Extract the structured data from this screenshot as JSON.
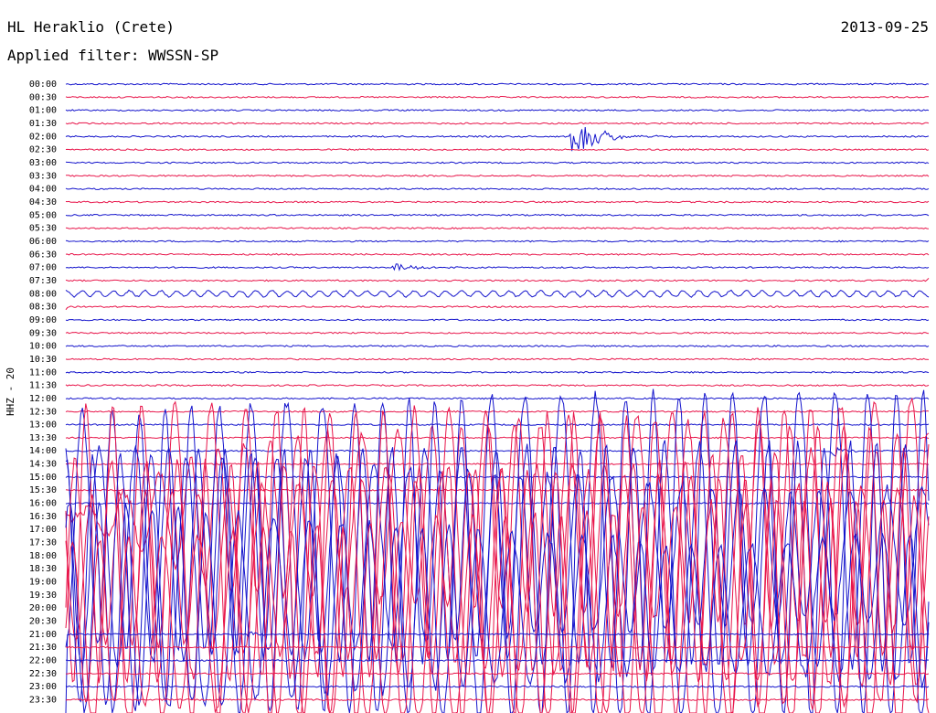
{
  "header": {
    "station": "HL Heraklio (Crete)",
    "date": "2013-09-25",
    "filter_text": "Applied filter: WWSSN-SP"
  },
  "channel_label": "HHZ - 20",
  "colors": {
    "trace_a": "#1414cc",
    "trace_b": "#e8154a"
  },
  "chart_data": {
    "type": "line",
    "title": "",
    "xlabel": "",
    "ylabel": "",
    "row_times": [
      "00:00",
      "00:30",
      "01:00",
      "01:30",
      "02:00",
      "02:30",
      "03:00",
      "03:30",
      "04:00",
      "04:30",
      "05:00",
      "05:30",
      "06:00",
      "06:30",
      "07:00",
      "07:30",
      "08:00",
      "08:30",
      "09:00",
      "09:30",
      "10:00",
      "10:30",
      "11:00",
      "11:30",
      "12:00",
      "12:30",
      "13:00",
      "13:30",
      "14:00",
      "14:30",
      "15:00",
      "15:30",
      "16:00",
      "16:30",
      "17:00",
      "17:30",
      "18:00",
      "18:30",
      "19:00",
      "19:30",
      "20:00",
      "20:30",
      "21:00",
      "21:30",
      "22:00",
      "22:30",
      "23:00",
      "23:30"
    ],
    "row_minutes": 30,
    "events": [
      {
        "start_hhmm": "02:00",
        "offset_min": 17.5,
        "duration_min": 3.5,
        "amplitude": "large"
      },
      {
        "start_hhmm": "07:00",
        "offset_min": 11.3,
        "duration_min": 3.5,
        "amplitude": "small"
      },
      {
        "start_hhmm": "08:00",
        "offset_min": 0,
        "duration_min": 30,
        "amplitude": "microseism"
      },
      {
        "start_hhmm": "14:00",
        "offset_min": 26.5,
        "duration_min": 2,
        "amplitude": "medium"
      },
      {
        "start_hhmm": "16:30",
        "offset_min": 0,
        "duration_min": 270,
        "amplitude": "saturated"
      },
      {
        "start_hhmm": "21:00",
        "offset_min": 6.3,
        "duration_min": 2,
        "amplitude": "small"
      }
    ]
  }
}
